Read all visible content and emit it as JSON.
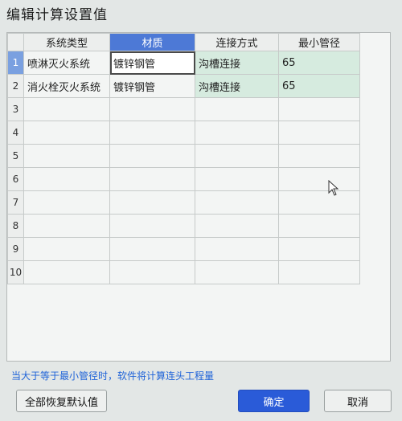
{
  "dialog": {
    "title": "编辑计算设置值",
    "hint": "当大于等于最小管径时，软件将计算连头工程量"
  },
  "table": {
    "headers": [
      "系统类型",
      "材质",
      "连接方式",
      "最小管径"
    ],
    "active_header_index": 1,
    "row_numbers": [
      "1",
      "2",
      "3",
      "4",
      "5",
      "6",
      "7",
      "8",
      "9",
      "10"
    ],
    "rows": [
      [
        "喷淋灭火系统",
        "镀锌钢管",
        "沟槽连接",
        "65"
      ],
      [
        "消火栓灭火系统",
        "镀锌钢管",
        "沟槽连接",
        "65"
      ]
    ]
  },
  "buttons": {
    "restore_defaults": "全部恢复默认值",
    "ok": "确定",
    "cancel": "取消"
  },
  "colors": {
    "accent": "#2a5bd8",
    "active_header": "#4d79d6",
    "filled_cell": "#d6ebdf",
    "hint_text": "#1f63d8"
  }
}
